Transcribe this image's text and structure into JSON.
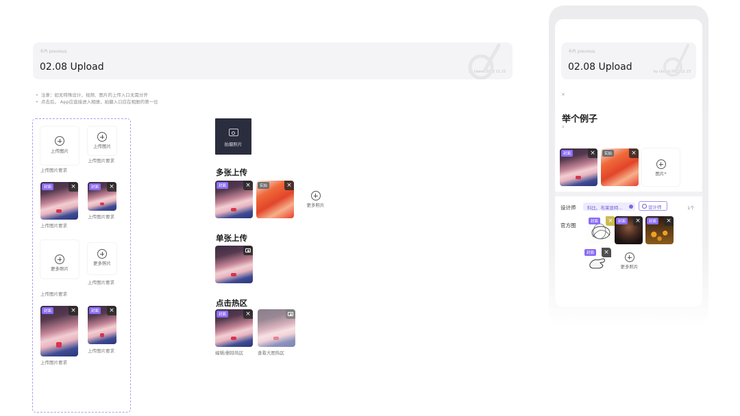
{
  "header": {
    "breadcrumb": "卡片 previous",
    "title": "02.08 Upload",
    "meta": "by closed 2022 11 23"
  },
  "notes": [
    "注意：如无特殊设计，视频、图片的上传入口无需分开",
    "点击后， App应直接进入相册，拍摄入口应在相册的第一位"
  ],
  "left_panel": {
    "upload_image": "上传图片",
    "upload_req": "上传图片要求",
    "more_photos": "更多照片",
    "cover_badge": "封面",
    "close_glyph": "×"
  },
  "middle": {
    "camera_tile": "拍摄照片",
    "multi_title": "多张上传",
    "live_badge": "实拍",
    "more_photos": "更多照片",
    "single_title": "单张上传",
    "hotspot_title": "点击热区",
    "edit_delete": "编辑/删除热区",
    "view_large": "查看大图热区"
  },
  "phone": {
    "breadcrumb": "卡片 previous",
    "title": "02.08 Upload",
    "meta": "by closed 2022 11 23",
    "close_glyph": "×",
    "example_title": "举个例子",
    "sub_mark": "x",
    "add_image": "图片*",
    "designer_label": "设计师",
    "tag_text": "科比、布莱恩特...",
    "designer_button": "设计师",
    "count": "1个",
    "official_label": "官方图",
    "more_photos": "更多照片"
  }
}
